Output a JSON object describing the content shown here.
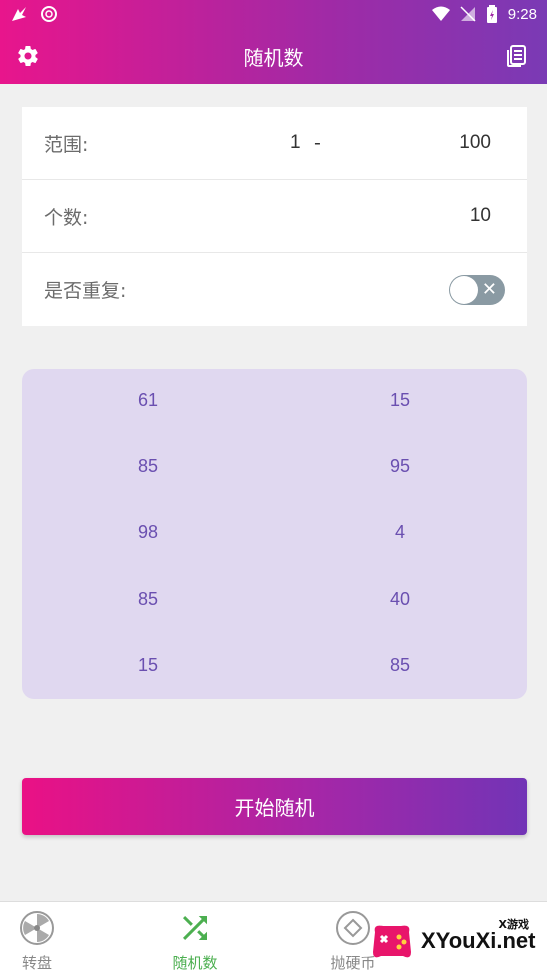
{
  "status_bar": {
    "time": "9:28"
  },
  "app_bar": {
    "title": "随机数",
    "left_icon": "gear-icon",
    "right_icon": "history-list-icon"
  },
  "settings": {
    "range_label": "范围:",
    "range_min": "1",
    "range_dash": "-",
    "range_max": "100",
    "count_label": "个数:",
    "count_value": "10",
    "repeat_label": "是否重复:",
    "repeat_enabled": false
  },
  "results": {
    "left": [
      "61",
      "85",
      "98",
      "85",
      "15"
    ],
    "right": [
      "15",
      "95",
      "4",
      "40",
      "85"
    ]
  },
  "start_button": {
    "label": "开始随机"
  },
  "bottom_nav": {
    "items": [
      {
        "label": "转盘",
        "icon": "wheel-icon",
        "active": false
      },
      {
        "label": "随机数",
        "icon": "shuffle-icon",
        "active": true
      },
      {
        "label": "抛硬币",
        "icon": "coin-icon",
        "active": false
      }
    ],
    "active_color": "#4caf50",
    "inactive_color": "#888888"
  },
  "watermark": {
    "text": "XYouXi.net",
    "small_text": "X游戏"
  },
  "colors": {
    "accent_start": "#e8158c",
    "accent_end": "#7a3ab5",
    "result_text": "#6a4fb0",
    "result_bg": "#e0d8f0"
  }
}
